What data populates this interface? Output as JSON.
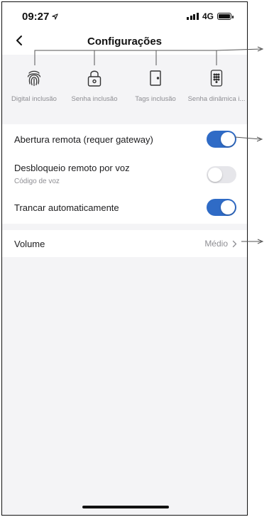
{
  "status": {
    "time": "09:27",
    "network": "4G"
  },
  "nav": {
    "title": "Configurações"
  },
  "shortcuts": [
    {
      "label": "Digital inclusão",
      "icon": "fingerprint-icon"
    },
    {
      "label": "Senha inclusão",
      "icon": "lock-icon"
    },
    {
      "label": "Tags inclusão",
      "icon": "door-icon"
    },
    {
      "label": "Senha dinâmica i...",
      "icon": "keypad-icon"
    }
  ],
  "settings": {
    "remote_open": {
      "title": "Abertura remota (requer gateway)",
      "enabled": true
    },
    "voice_unlock": {
      "title": "Desbloqueio remoto por voz",
      "subtitle": "Código de voz",
      "enabled": false
    },
    "auto_lock": {
      "title": "Trancar automaticamente",
      "enabled": true
    },
    "volume": {
      "title": "Volume",
      "value": "Médio"
    }
  },
  "colors": {
    "accent": "#2f6bc6",
    "toggle_off": "#e6e6ea"
  }
}
